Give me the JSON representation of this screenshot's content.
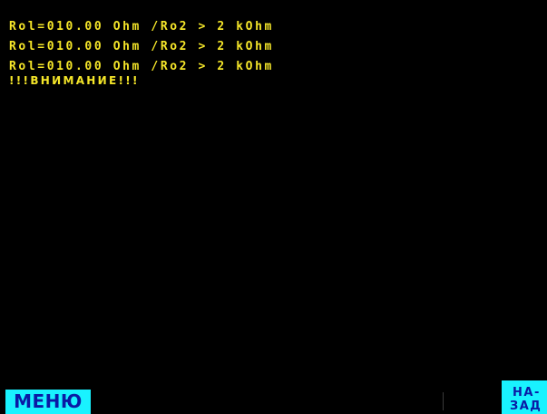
{
  "screen": {
    "lines": [
      "Rol=010.00 Ohm /Ro2 > 2 kOhm",
      "Rol=010.00 Ohm /Ro2 > 2 kOhm",
      "Rol=010.00 Ohm /Ro2 > 2 kOhm"
    ],
    "warning": "!!!ВНИМАНИЕ!!!"
  },
  "footer": {
    "menu_label": "МЕНЮ",
    "back_label_line1": "НА-",
    "back_label_line2": "ЗАД"
  },
  "colors": {
    "background": "#000000",
    "text": "#f5e629",
    "button_background": "#19f2ff",
    "button_text": "#0a1aa5"
  }
}
